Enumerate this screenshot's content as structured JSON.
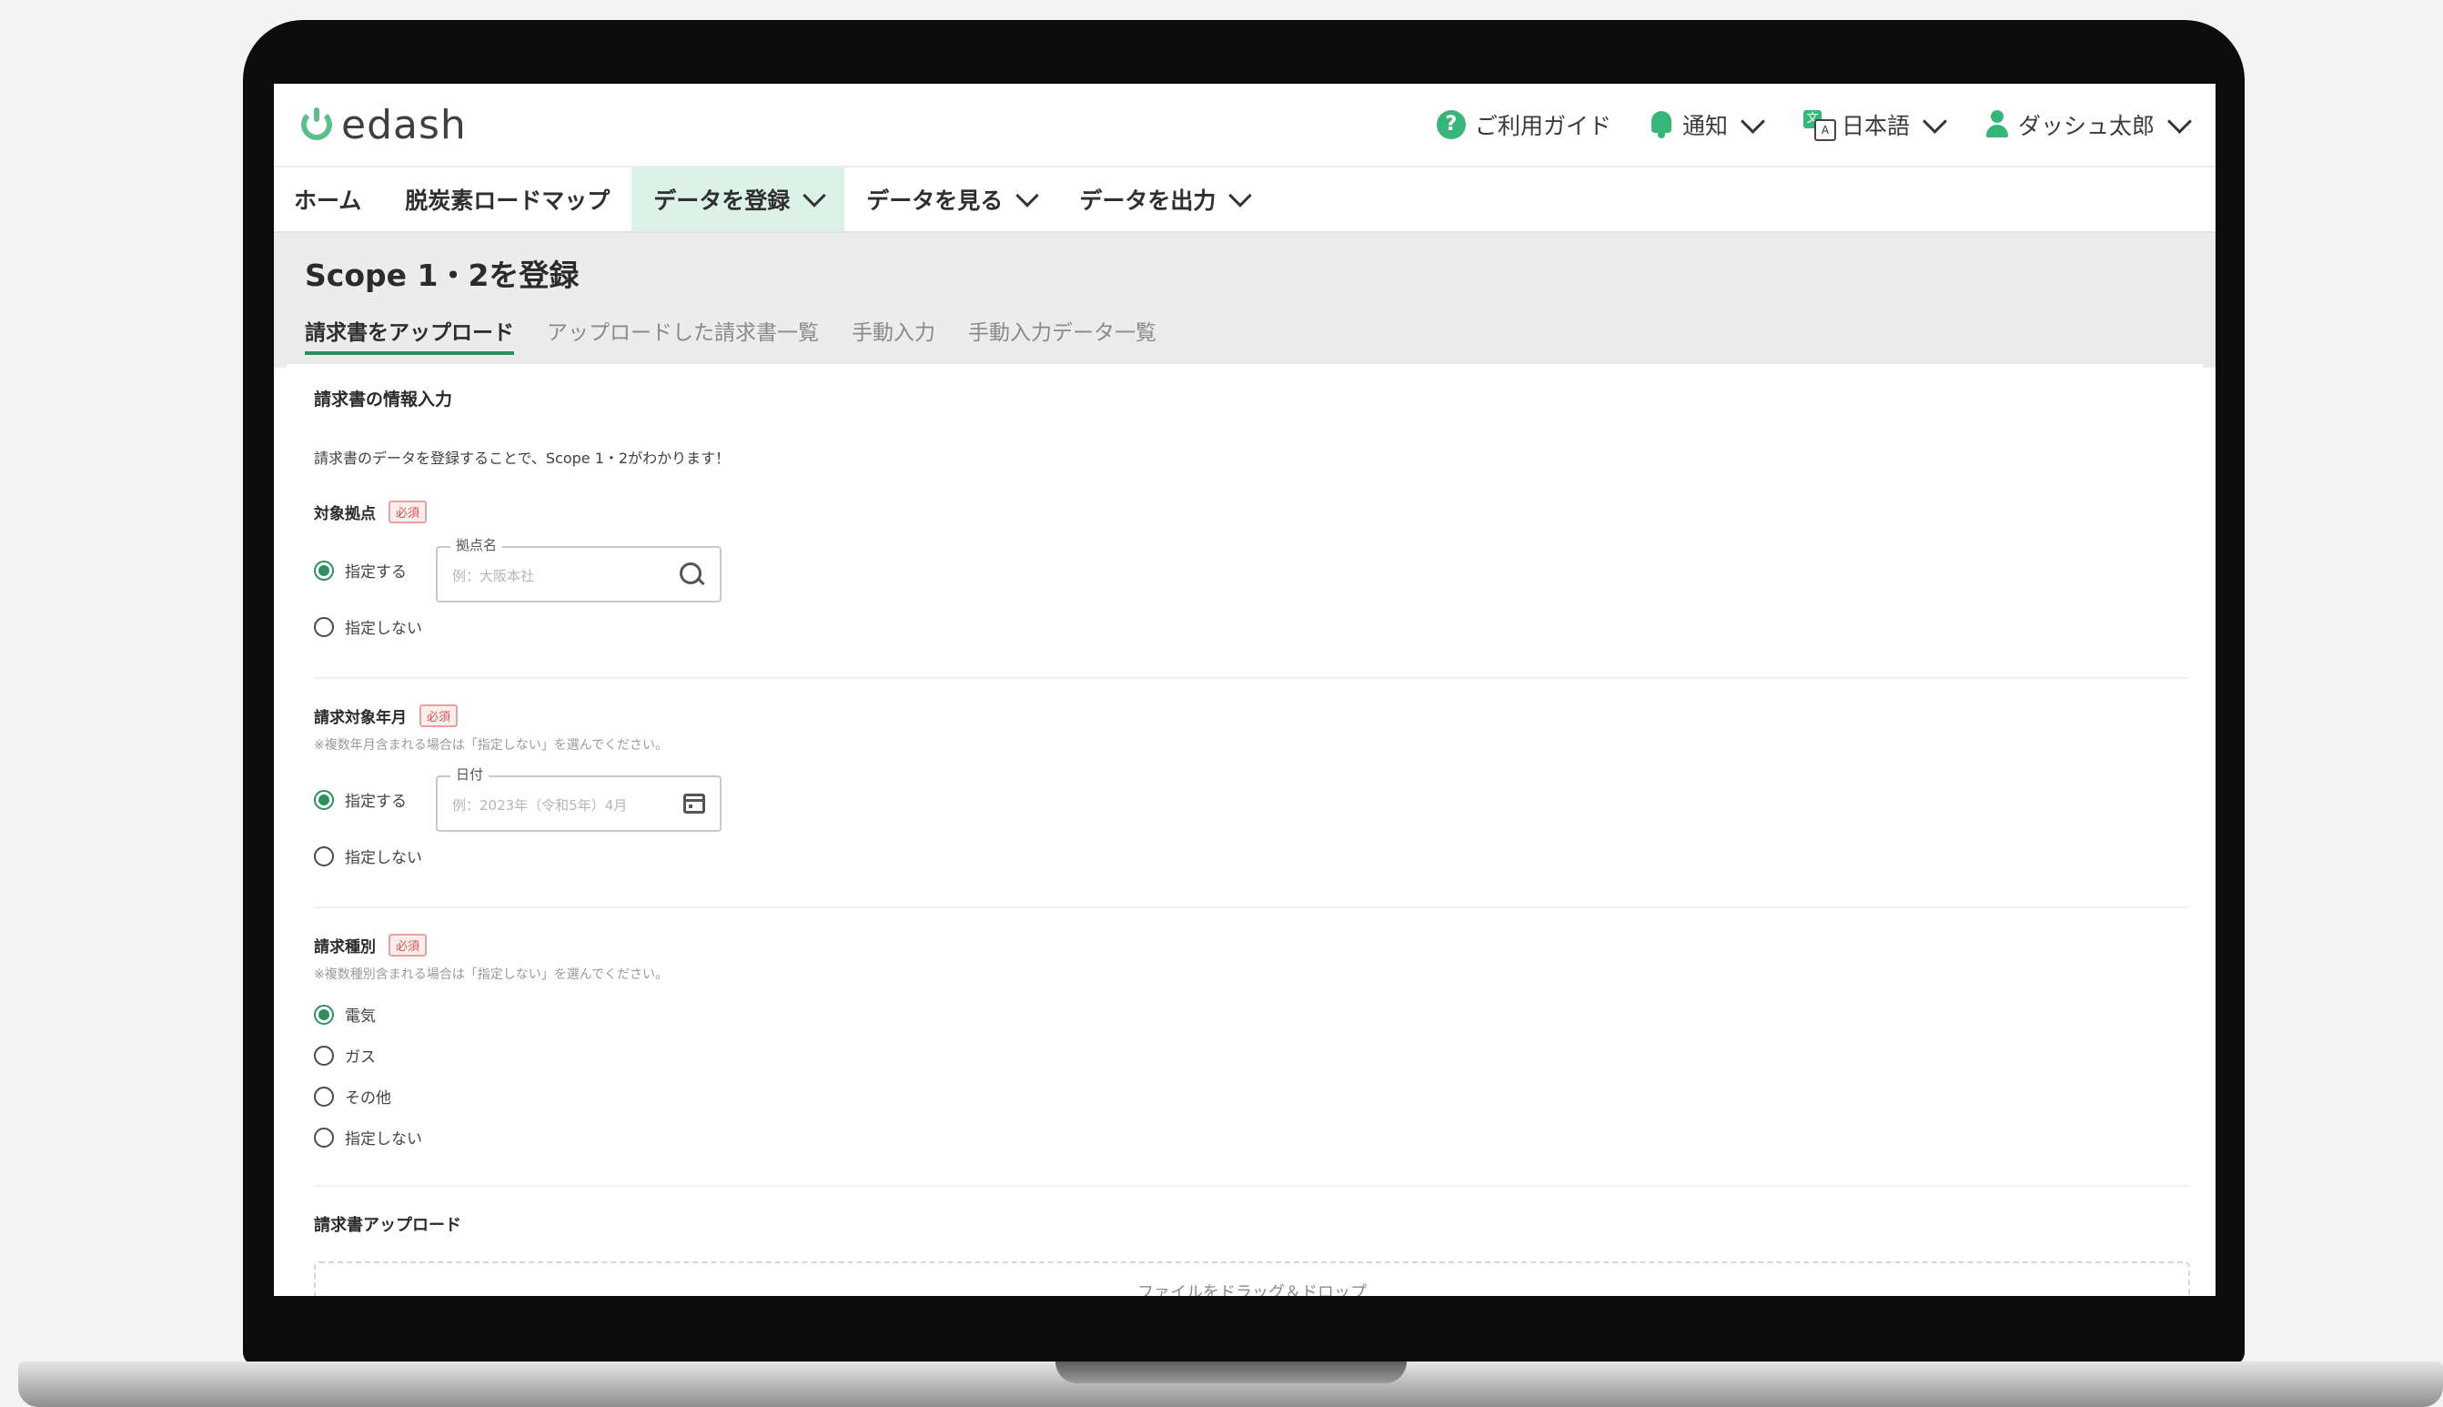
{
  "app": {
    "logo_text": "edash",
    "brand_color": "#38b67a",
    "accent_color": "#2e8f5f"
  },
  "header": {
    "guide": "ご利用ガイド",
    "notifications": "通知",
    "language": "日本語",
    "user": "ダッシュ太郎",
    "lang_icon_a": "文",
    "lang_icon_b": "A"
  },
  "nav": {
    "items": [
      {
        "label": "ホーム"
      },
      {
        "label": "脱炭素ロードマップ"
      },
      {
        "label": "データを登録"
      },
      {
        "label": "データを見る"
      },
      {
        "label": "データを出力"
      }
    ]
  },
  "page": {
    "title": "Scope 1・2を登録",
    "tabs": [
      {
        "label": "請求書をアップロード"
      },
      {
        "label": "アップロードした請求書一覧"
      },
      {
        "label": "手動入力"
      },
      {
        "label": "手動入力データ一覧"
      }
    ]
  },
  "form": {
    "section_title": "請求書の情報入力",
    "description": "請求書のデータを登録することで、Scope 1・2がわかります！",
    "required_badge": "必須",
    "site": {
      "label": "対象拠点",
      "option_specify": "指定する",
      "option_none": "指定しない",
      "field_legend": "拠点名",
      "placeholder": "例：大阪本社"
    },
    "period": {
      "label": "請求対象年月",
      "note": "※複数年月含まれる場合は「指定しない」を選んでください。",
      "option_specify": "指定する",
      "option_none": "指定しない",
      "field_legend": "日付",
      "placeholder": "例：2023年（令和5年）4月"
    },
    "type": {
      "label": "請求種別",
      "note": "※複数種別含まれる場合は「指定しない」を選んでください。",
      "options": [
        {
          "label": "電気"
        },
        {
          "label": "ガス"
        },
        {
          "label": "その他"
        },
        {
          "label": "指定しない"
        }
      ]
    },
    "upload": {
      "title": "請求書アップロード",
      "dropzone_text": "ファイルをドラッグ＆ドロップ"
    }
  }
}
